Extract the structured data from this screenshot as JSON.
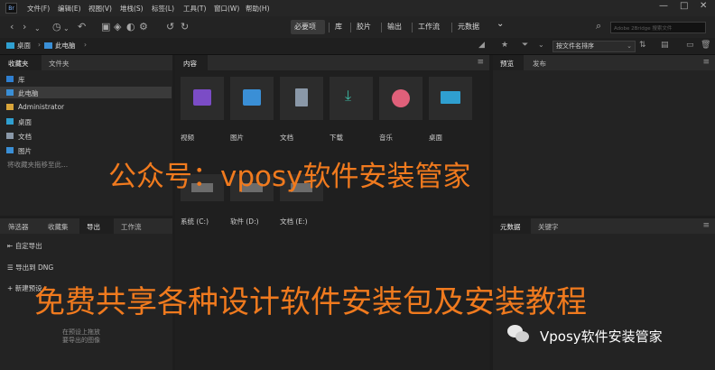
{
  "app": {
    "icon_label": "Br",
    "accent": "#3f8ef6"
  },
  "menubar": {
    "items": [
      "文件(F)",
      "编辑(E)",
      "视图(V)",
      "堆栈(S)",
      "标签(L)",
      "工具(T)",
      "窗口(W)",
      "帮助(H)"
    ],
    "window_controls": [
      "—",
      "□",
      "✕"
    ]
  },
  "toolbar": {
    "workspaces": [
      "必要项",
      "库",
      "胶片",
      "输出",
      "工作流",
      "元数据"
    ],
    "active_workspace": "必要项",
    "more_label": "⌄",
    "search_placeholder": "Adobe 2Bridge 搜索文件"
  },
  "pathbar": {
    "crumbs": [
      "桌面",
      "此电脑"
    ],
    "sort_label": "按文件名排序"
  },
  "left_panel": {
    "tabs": [
      "收藏夹",
      "文件夹"
    ],
    "favorites": [
      "库",
      "此电脑",
      "Administrator",
      "桌面",
      "文档",
      "图片"
    ],
    "hint": "将收藏夹拖移至此..."
  },
  "export_panel": {
    "tabs": [
      "筛选器",
      "收藏集",
      "导出",
      "工作流"
    ],
    "items": [
      "自定导出",
      "导出到 DNG",
      "新建预设"
    ],
    "hint_lines": [
      "在预设上拖放",
      "要导出的图像"
    ]
  },
  "content": {
    "tab": "内容",
    "tiles": [
      {
        "label": "视频",
        "icon": "video-folder-icon",
        "color": "#7b4cc6"
      },
      {
        "label": "图片",
        "icon": "pictures-folder-icon",
        "color": "#3a8fd6"
      },
      {
        "label": "文档",
        "icon": "documents-folder-icon",
        "color": "#8a98a8"
      },
      {
        "label": "下载",
        "icon": "downloads-folder-icon",
        "color": "#3bb7a2"
      },
      {
        "label": "音乐",
        "icon": "music-folder-icon",
        "color": "#e0607a"
      },
      {
        "label": "桌面",
        "icon": "desktop-folder-icon",
        "color": "#2f9fd0"
      }
    ],
    "drives": [
      "系统 (C:)",
      "软件 (D:)",
      "文档 (E:)"
    ]
  },
  "preview_panel": {
    "tabs": [
      "预览",
      "发布"
    ]
  },
  "metadata_panel": {
    "tabs": [
      "元数据",
      "关键字"
    ]
  },
  "watermark": {
    "line1": "公众号：vposy软件安装管家",
    "line2": "免费共享各种设计软件安装包及安装教程",
    "badge": "Vposy软件安装管家",
    "color": "#f07a1e"
  }
}
